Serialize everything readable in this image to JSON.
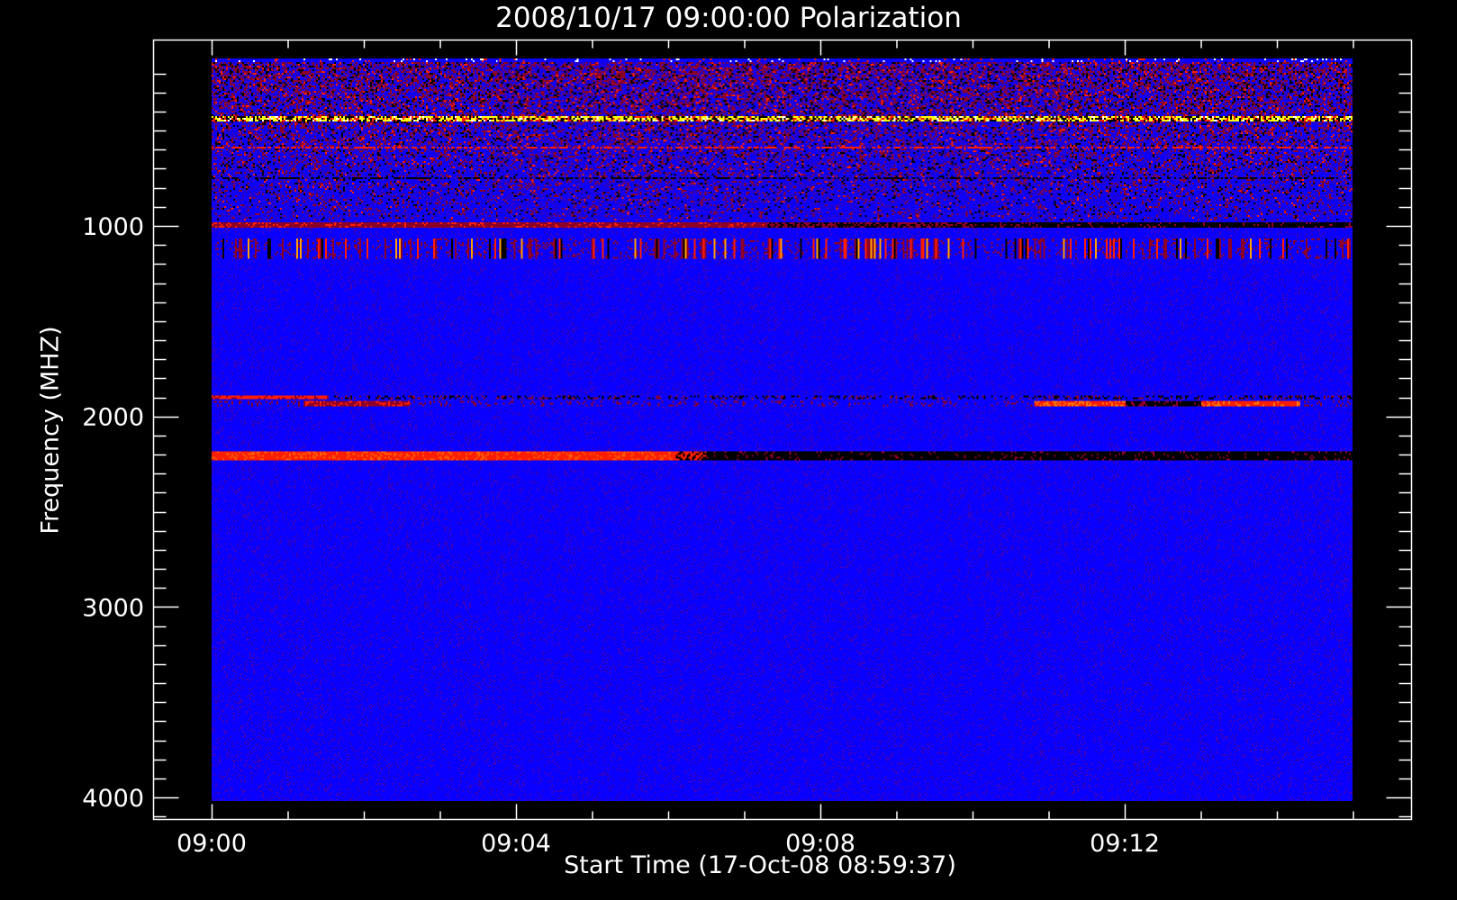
{
  "chart_data": {
    "type": "heatmap",
    "title": "2008/10/17 09:00:00 Polarization",
    "xlabel": "Start Time (17-Oct-08 08:59:37)",
    "ylabel": "Frequency (MHZ)",
    "x_unit": "minutes after 09:00",
    "xlim": [
      -0.75,
      15.8
    ],
    "data_xlim": [
      0,
      15
    ],
    "ylim": [
      100,
      4120
    ],
    "data_ylim": [
      100,
      4020
    ],
    "y_inverted": true,
    "x_ticks": [
      {
        "value": 0,
        "label": "09:00"
      },
      {
        "value": 4,
        "label": "09:04"
      },
      {
        "value": 8,
        "label": "09:08"
      },
      {
        "value": 12,
        "label": "09:12"
      }
    ],
    "x_minor_step": 1,
    "y_ticks": [
      {
        "value": 1000,
        "label": "1000"
      },
      {
        "value": 2000,
        "label": "2000"
      },
      {
        "value": 3000,
        "label": "3000"
      },
      {
        "value": 4000,
        "label": "4000"
      }
    ],
    "y_minor_step": 100,
    "colormap": [
      "#000000",
      "#0000ff",
      "#8b0000",
      "#ff2000",
      "#ffff00",
      "#ffffff"
    ],
    "features": [
      {
        "freq": [
          100,
          950
        ],
        "desc": "noisy RFI region"
      },
      {
        "freq": [
          400,
          420
        ],
        "desc": "bright yellow band"
      },
      {
        "freq": [
          960,
          980
        ],
        "desc": "red band fading to black after 09:07"
      },
      {
        "freq": [
          1050,
          1150
        ],
        "desc": "speckled vertical streaks"
      },
      {
        "freq": [
          1880,
          1930
        ],
        "desc": "red/black band segments"
      },
      {
        "freq": [
          2170,
          2210
        ],
        "desc": "bright red band to 09:06, black afterwards"
      }
    ]
  }
}
